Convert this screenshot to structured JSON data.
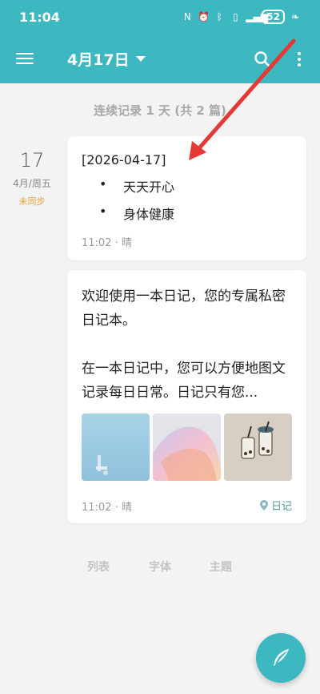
{
  "status": {
    "time": "11:04",
    "battery": "52"
  },
  "appbar": {
    "date_label": "4月17日"
  },
  "summary": "连续记录 1 天 (共 2 篇)",
  "day": {
    "num": "17",
    "week": "4月/周五",
    "sync": "未同步"
  },
  "entry1": {
    "date": "[2026-04-17]",
    "items": [
      {
        "bullet": "•",
        "text": "天天开心"
      },
      {
        "bullet": "•",
        "text": "身体健康"
      }
    ],
    "time": "11:02",
    "weather": "晴"
  },
  "entry2": {
    "para1": "欢迎使用一本日记，您的专属私密日记本。",
    "para2": "在一本日记中，您可以方便地图文记录每日日常。日记只有您...",
    "time": "11:02",
    "weather": "晴",
    "tag": "日记"
  },
  "tabs": [
    "列表",
    "字体",
    "主题"
  ],
  "colors": {
    "accent": "#3db8c0",
    "sync": "#e8a33a",
    "annotation": "#e53935"
  },
  "icons": {
    "menu": "menu-icon",
    "dropdown": "caret-down-icon",
    "search": "search-icon",
    "more": "more-vert-icon",
    "location": "location-pin-icon",
    "compose": "feather-pen-icon"
  }
}
